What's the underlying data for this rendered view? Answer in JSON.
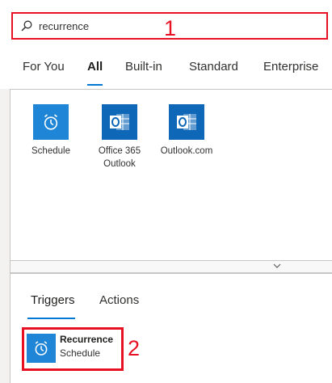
{
  "search": {
    "value": "recurrence"
  },
  "annotations": {
    "first": "1",
    "second": "2"
  },
  "category_tabs": [
    {
      "label": "For You",
      "active": false
    },
    {
      "label": "All",
      "active": true
    },
    {
      "label": "Built-in",
      "active": false
    },
    {
      "label": "Standard",
      "active": false
    },
    {
      "label": "Enterprise",
      "active": false
    }
  ],
  "connectors": [
    {
      "label": "Schedule",
      "icon": "alarm-clock-icon"
    },
    {
      "label": "Office 365\nOutlook",
      "icon": "outlook-icon"
    },
    {
      "label": "Outlook.com",
      "icon": "outlook-icon"
    }
  ],
  "result_tabs": [
    {
      "label": "Triggers",
      "active": true
    },
    {
      "label": "Actions",
      "active": false
    }
  ],
  "result": {
    "name": "Recurrence",
    "connector": "Schedule",
    "icon": "alarm-clock-icon"
  },
  "colors": {
    "accent": "#0078d4",
    "highlight": "#e81123",
    "tile_blue": "#1f85d6",
    "outlook_blue": "#0f67b8"
  }
}
